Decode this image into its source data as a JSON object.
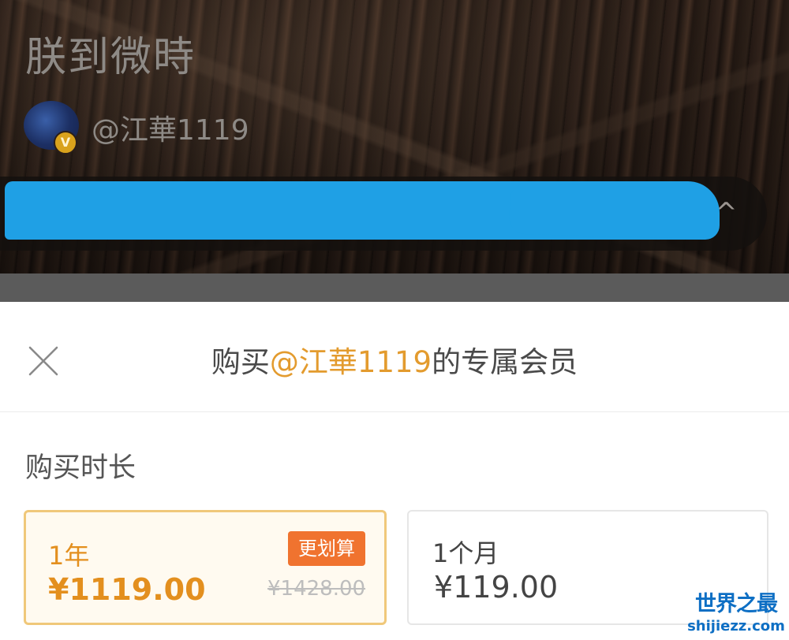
{
  "profile": {
    "title": "朕到微時",
    "handle": "@江華1119",
    "verified_badge": "V",
    "redaction_color": "#1fa0e5",
    "pill_chevron": "^"
  },
  "purchase": {
    "title_prefix": "购买",
    "title_highlight": "@江華1119",
    "title_suffix": "的专属会员",
    "section_label": "购买时长",
    "highlight_color": "#e39b2e",
    "plans": [
      {
        "duration": "1年",
        "price": "¥1119.00",
        "badge": "更划算",
        "original_price": "¥1428.00",
        "selected": true
      },
      {
        "duration": "1个月",
        "price": "¥119.00",
        "selected": false
      }
    ]
  },
  "watermark": {
    "cn": "世界之最",
    "en": "shijiezz.com"
  },
  "icons": [
    "close-icon",
    "verified-badge-icon",
    "chevron-up-icon"
  ]
}
